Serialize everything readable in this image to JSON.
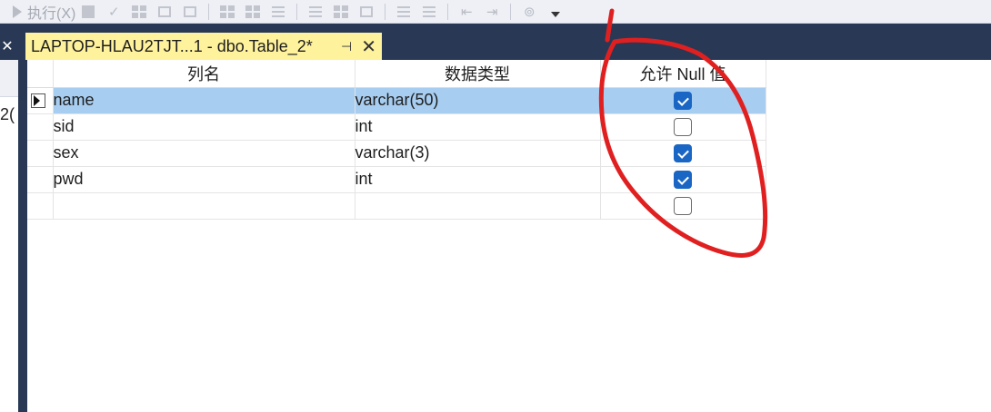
{
  "toolbar": {
    "execute_label": "执行(X)"
  },
  "tab": {
    "title": "LAPTOP-HLAU2TJT...1 - dbo.Table_2*",
    "pin_glyph": "⊣",
    "close_glyph": "✕"
  },
  "left_panel": {
    "close_glyph": "✕",
    "partial_text": "2("
  },
  "grid": {
    "headers": {
      "column_name": "列名",
      "data_type": "数据类型",
      "allow_null": "允许 Null 值"
    },
    "rows": [
      {
        "name": "name",
        "type": "varchar(50)",
        "allow_null": true,
        "selected": true
      },
      {
        "name": "sid",
        "type": "int",
        "allow_null": false,
        "selected": false
      },
      {
        "name": "sex",
        "type": "varchar(3)",
        "allow_null": true,
        "selected": false
      },
      {
        "name": "pwd",
        "type": "int",
        "allow_null": true,
        "selected": false
      },
      {
        "name": "",
        "type": "",
        "allow_null": false,
        "selected": false
      }
    ]
  },
  "colors": {
    "toolbar_bg": "#eef0f6",
    "frame_dark": "#293955",
    "tab_active": "#fff29d",
    "selected_row": "#a7cdf0",
    "checkbox_checked": "#1a66c4",
    "annotation_red": "#e02020"
  }
}
